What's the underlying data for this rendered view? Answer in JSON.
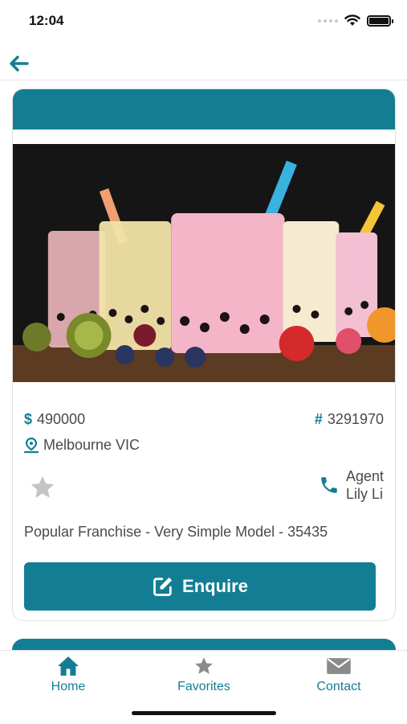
{
  "status_bar": {
    "time": "12:04"
  },
  "listing": {
    "price": "490000",
    "id": "3291970",
    "location": "Melbourne VIC",
    "agent_title": "Agent",
    "agent_name": "Lily Li",
    "description": "Popular Franchise - Very Simple Model - 35435",
    "currency_symbol": "$",
    "id_symbol": "#",
    "image_subject": "bubble tea drinks with fruit",
    "enquire_label": "Enquire"
  },
  "tabs": [
    {
      "label": "Home",
      "icon": "home-icon"
    },
    {
      "label": "Favorites",
      "icon": "star-icon"
    },
    {
      "label": "Contact",
      "icon": "envelope-icon"
    }
  ],
  "colors": {
    "accent": "#137e93",
    "text": "#4a4a4a",
    "inactive_star": "#c4c4c4"
  }
}
